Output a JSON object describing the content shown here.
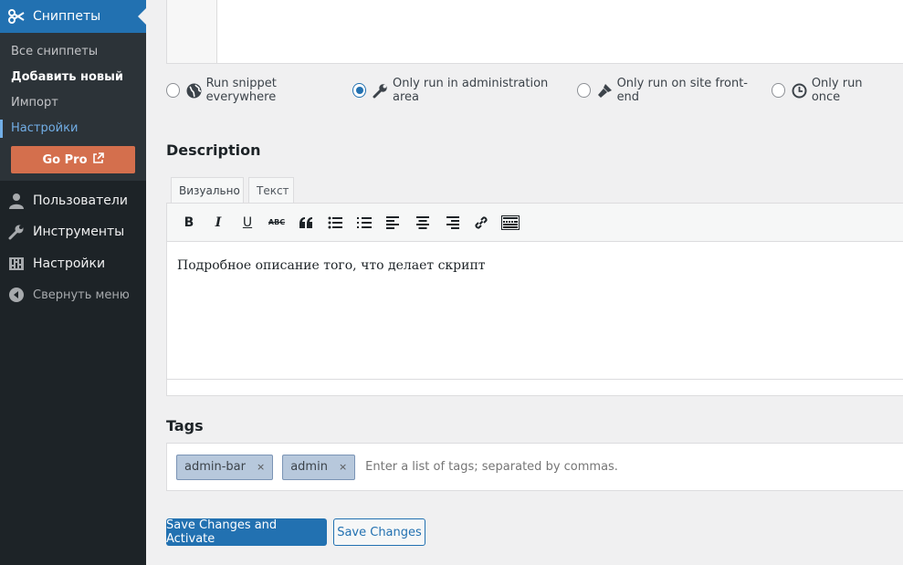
{
  "sidebar": {
    "active_menu": "Сниппеты",
    "submenu": [
      "Все сниппеты",
      "Добавить новый",
      "Импорт",
      "Настройки"
    ],
    "go_pro": "Go Pro",
    "items": [
      {
        "label": "Пользователи",
        "icon": "user-icon"
      },
      {
        "label": "Инструменты",
        "icon": "wrench-icon"
      },
      {
        "label": "Настройки",
        "icon": "settings-icon"
      }
    ],
    "collapse": "Свернуть меню"
  },
  "scope": {
    "options": [
      {
        "label": "Run snippet everywhere",
        "icon": "globe-icon",
        "checked": false
      },
      {
        "label": "Only run in administration area",
        "icon": "wrench-icon",
        "checked": true
      },
      {
        "label": "Only run on site front-end",
        "icon": "paintbrush-icon",
        "checked": false
      },
      {
        "label": "Only run once",
        "icon": "clock-icon",
        "checked": false
      }
    ]
  },
  "description": {
    "heading": "Description",
    "tabs": [
      "Визуально",
      "Текст"
    ],
    "active_tab": "Визуально",
    "content": "Подробное описание того, что делает скрипт"
  },
  "tags": {
    "heading": "Tags",
    "items": [
      "admin-bar",
      "admin"
    ],
    "remove_glyph": "×",
    "placeholder": "Enter a list of tags; separated by commas."
  },
  "actions": {
    "save_activate": "Save Changes and Activate",
    "save": "Save Changes"
  },
  "colors": {
    "accent": "#2271b1",
    "sidebar_bg": "#1d2327",
    "go_pro_bg": "#d46f4d",
    "tag_bg": "#b7c8dc"
  }
}
